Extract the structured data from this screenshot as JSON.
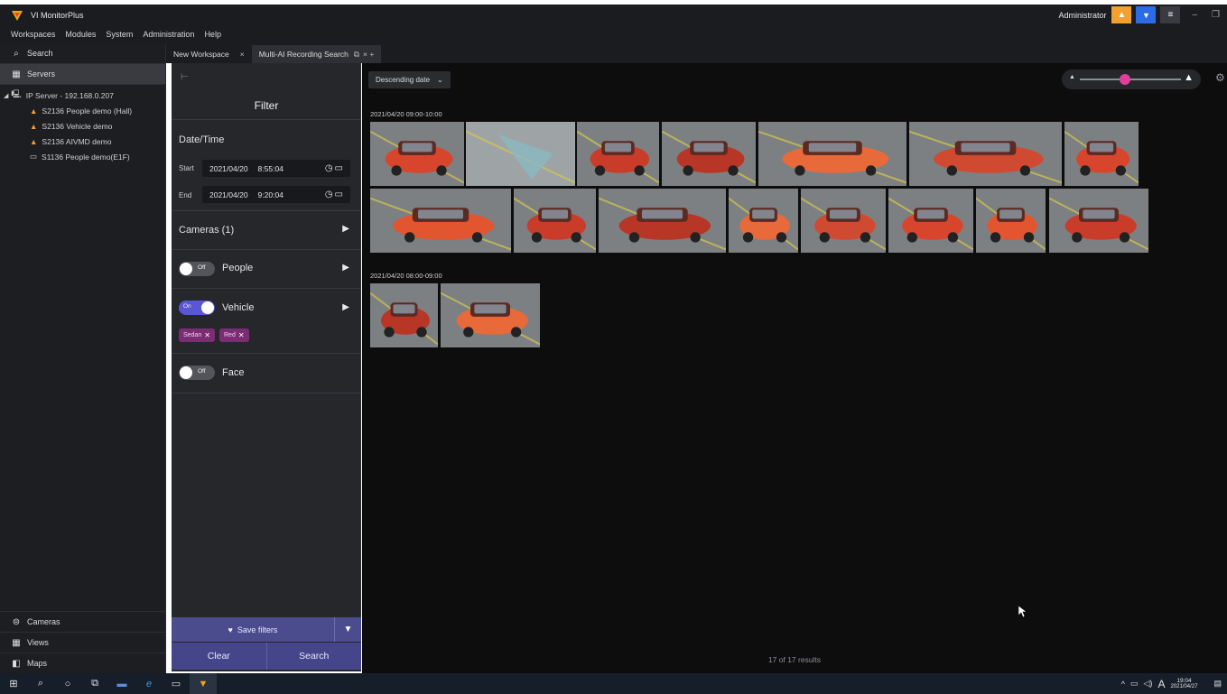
{
  "app": {
    "title": "VI MonitorPlus",
    "user": "Administrator"
  },
  "menu": [
    "Workspaces",
    "Modules",
    "System",
    "Administration",
    "Help"
  ],
  "sidebar": {
    "search": "Search",
    "servers": "Servers",
    "tree": [
      {
        "label": "IP Server - 192.168.0.207",
        "level": 0,
        "icon": "server-icon"
      },
      {
        "label": "S2136 People demo (Hall)",
        "level": 1,
        "icon": "camera-warning-icon"
      },
      {
        "label": "S2136 Vehicle demo",
        "level": 1,
        "icon": "camera-warning-icon"
      },
      {
        "label": "S2136 AIVMD demo",
        "level": 1,
        "icon": "camera-warning-icon"
      },
      {
        "label": "S1136 People demo(E1F)",
        "level": 1,
        "icon": "camera-icon"
      }
    ],
    "cameras": "Cameras",
    "views": "Views",
    "maps": "Maps"
  },
  "tabs": [
    {
      "label": "New Workspace",
      "close": "×"
    },
    {
      "label": "Multi-AI Recording Search",
      "close": "× +"
    }
  ],
  "filter": {
    "title": "Filter",
    "datetime_label": "Date/Time",
    "start_label": "Start",
    "start_date": "2021/04/20",
    "start_time": "8:55:04",
    "end_label": "End",
    "end_date": "2021/04/20",
    "end_time": "9:20:04",
    "cameras_label": "Cameras (1)",
    "people": {
      "label": "People",
      "state": "Off"
    },
    "vehicle": {
      "label": "Vehicle",
      "state": "On"
    },
    "chips": [
      "Sedan",
      "Red"
    ],
    "face": {
      "label": "Face",
      "state": "Off"
    },
    "save_label": "Save filters",
    "clear_label": "Clear",
    "search_label": "Search"
  },
  "results": {
    "sort": "Descending date",
    "group1_label": "2021/04/20 09:00-10:00",
    "group2_label": "2021/04/20 08:00-09:00",
    "count": "17 of 17 results"
  },
  "taskbar": {
    "time": "19:04",
    "date": "2021/04/27",
    "lang": "A"
  },
  "colors": {
    "accent": "#4b4c8e",
    "chip": "#7b2d74",
    "toggle_on": "#5a57d6",
    "slider_knob": "#e0409a",
    "title_orange": "#f2a030",
    "title_blue": "#2c6be6"
  }
}
